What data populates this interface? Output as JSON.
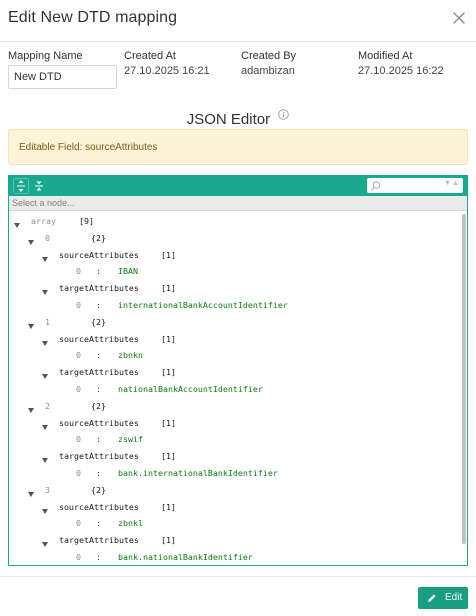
{
  "dialog": {
    "title": "Edit New DTD mapping"
  },
  "meta": {
    "mapping_name_label": "Mapping Name",
    "mapping_name_value": "New DTD",
    "created_at_label": "Created At",
    "created_at_value": "27.10.2025 16:21",
    "created_by_label": "Created By",
    "created_by_value": "adambizan",
    "modified_at_label": "Modified At",
    "modified_at_value": "27.10.2025 16:22"
  },
  "editor": {
    "title": "JSON Editor",
    "alert": "Editable Field: sourceAttributes",
    "nav_placeholder": "Select a node...",
    "tree": {
      "root_key": "array",
      "root_count": "[9]",
      "items": [
        {
          "index": "0",
          "count": "{2}",
          "source_key": "sourceAttributes",
          "source_count": "[1]",
          "source_index": "0",
          "source_value": "IBAN",
          "target_key": "targetAttributes",
          "target_count": "[1]",
          "target_index": "0",
          "target_value": "internationalBankAccountIdentifier"
        },
        {
          "index": "1",
          "count": "{2}",
          "source_key": "sourceAttributes",
          "source_count": "[1]",
          "source_index": "0",
          "source_value": "zbnkn",
          "target_key": "targetAttributes",
          "target_count": "[1]",
          "target_index": "0",
          "target_value": "nationalBankAccountIdentifier"
        },
        {
          "index": "2",
          "count": "{2}",
          "source_key": "sourceAttributes",
          "source_count": "[1]",
          "source_index": "0",
          "source_value": "zswif",
          "target_key": "targetAttributes",
          "target_count": "[1]",
          "target_index": "0",
          "target_value": "bank.internationalBankIdentifier"
        },
        {
          "index": "3",
          "count": "{2}",
          "source_key": "sourceAttributes",
          "source_count": "[1]",
          "source_index": "0",
          "source_value": "zbnkl",
          "target_key": "targetAttributes",
          "target_count": "[1]",
          "target_index": "0",
          "target_value": "bank.nationalBankIdentifier"
        }
      ],
      "colon": ":"
    }
  },
  "footer": {
    "edit_label": "Edit"
  },
  "icons": {
    "close": "close-icon",
    "info": "info-icon",
    "expand_all": "expand-all-icon",
    "collapse_all": "collapse-all-icon",
    "search": "search-icon",
    "search_nav": "search-prev-next-icons",
    "pencil": "pencil-icon",
    "expander": "triangle-down-icon"
  },
  "colors": {
    "accent": "#1ba891",
    "button": "#179e83",
    "alert_bg": "#fcf3d8",
    "alert_text": "#7a5d16",
    "value_text": "#0d7a10"
  }
}
